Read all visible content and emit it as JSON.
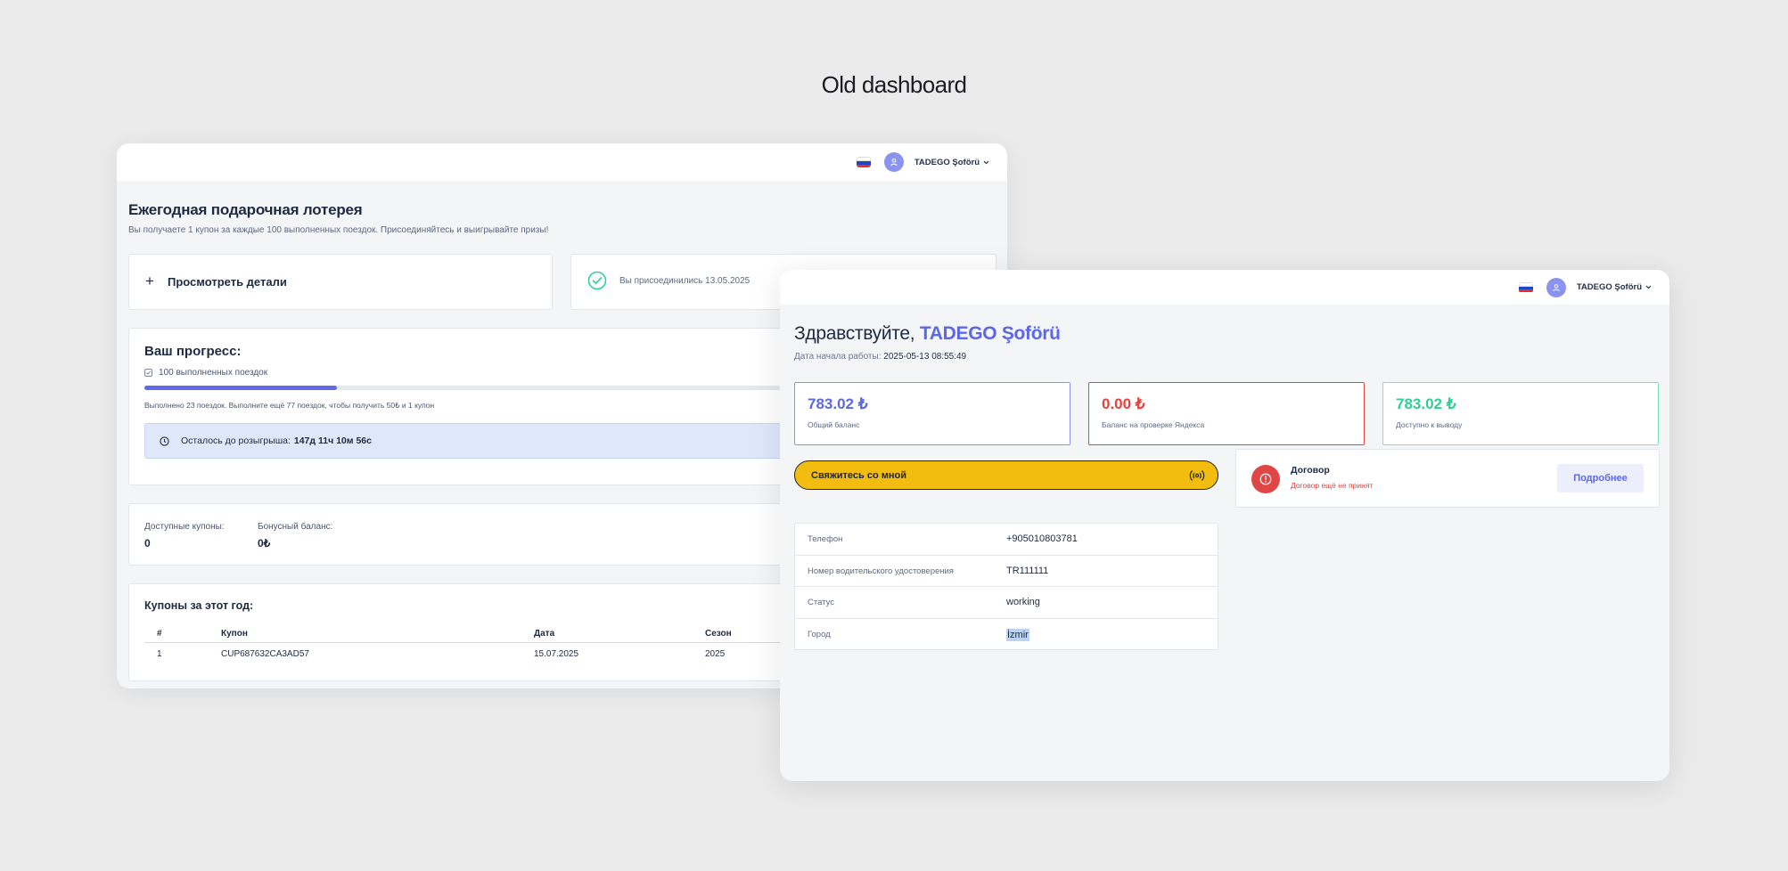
{
  "page": {
    "title": "Old dashboard"
  },
  "colors": {
    "accent": "#5c67e6",
    "danger": "#e0443f",
    "success": "#2fcf96",
    "cta": "#f2bd0e",
    "background": "#ebebeb"
  },
  "lottery_window": {
    "header": {
      "flag_icon": "flag-russia-icon",
      "avatar_icon": "user-icon",
      "username": "TADEGO Şoförü"
    },
    "title": "Ежегодная подарочная лотерея",
    "subtitle": "Вы получаете 1 купон за каждые 100 выполненных поездок. Присоединяйтесь и выигрывайте призы!",
    "details_button": {
      "icon": "plus-icon",
      "label": "Просмотреть детали"
    },
    "joined": {
      "icon": "check-circle-icon",
      "text": "Вы присоединились 13.05.2025"
    },
    "progress": {
      "title": "Ваш прогресс:",
      "task_icon": "checkbox-icon",
      "task": "100 выполненных поездок",
      "completed_trips": 23,
      "required_trips": 100,
      "note": "Выполнено 23 поездок. Выполните ещё 77 поездок, чтобы получить 50₺ и 1 купон",
      "timer_icon": "clock-icon",
      "timer_label": "Осталось до розыгрыша:",
      "timer_value": "147д 11ч 10м 56с"
    },
    "balances": {
      "coupons_label": "Доступные купоны:",
      "coupons_value": "0",
      "bonus_label": "Бонусный баланс:",
      "bonus_value": "0₺"
    },
    "coupons": {
      "title": "Купоны за этот год:",
      "columns": [
        "#",
        "Купон",
        "Дата",
        "Сезон"
      ],
      "rows": [
        [
          "1",
          "CUP687632CA3AD57",
          "15.07.2025",
          "2025"
        ]
      ]
    }
  },
  "profile_window": {
    "header": {
      "flag_icon": "flag-russia-icon",
      "avatar_icon": "user-icon",
      "username": "TADEGO Şoförü"
    },
    "greeting": "Здравствуйте,",
    "name": "TADEGO Şoförü",
    "start_label": "Дата начала работы:",
    "start_value": "2025-05-13 08:55:49",
    "balances": [
      {
        "amount": "783.02 ₺",
        "caption": "Общий баланс"
      },
      {
        "amount": "0.00 ₺",
        "caption": "Баланс на проверке Яндекса"
      },
      {
        "amount": "783.02 ₺",
        "caption": "Доступно к выводу"
      }
    ],
    "contact_button": {
      "label": "Свяжитесь со мной",
      "icon": "broadcast-icon"
    },
    "contract": {
      "icon": "alert-icon",
      "title": "Договор",
      "status": "Договор ещё не принят",
      "button": "Подробнее"
    },
    "info": [
      {
        "label": "Телефон",
        "value": "+905010803781"
      },
      {
        "label": "Номер водительского удостоверения",
        "value": "TR111111"
      },
      {
        "label": "Статус",
        "value": "working"
      },
      {
        "label": "Город",
        "value": "İzmir"
      }
    ]
  }
}
